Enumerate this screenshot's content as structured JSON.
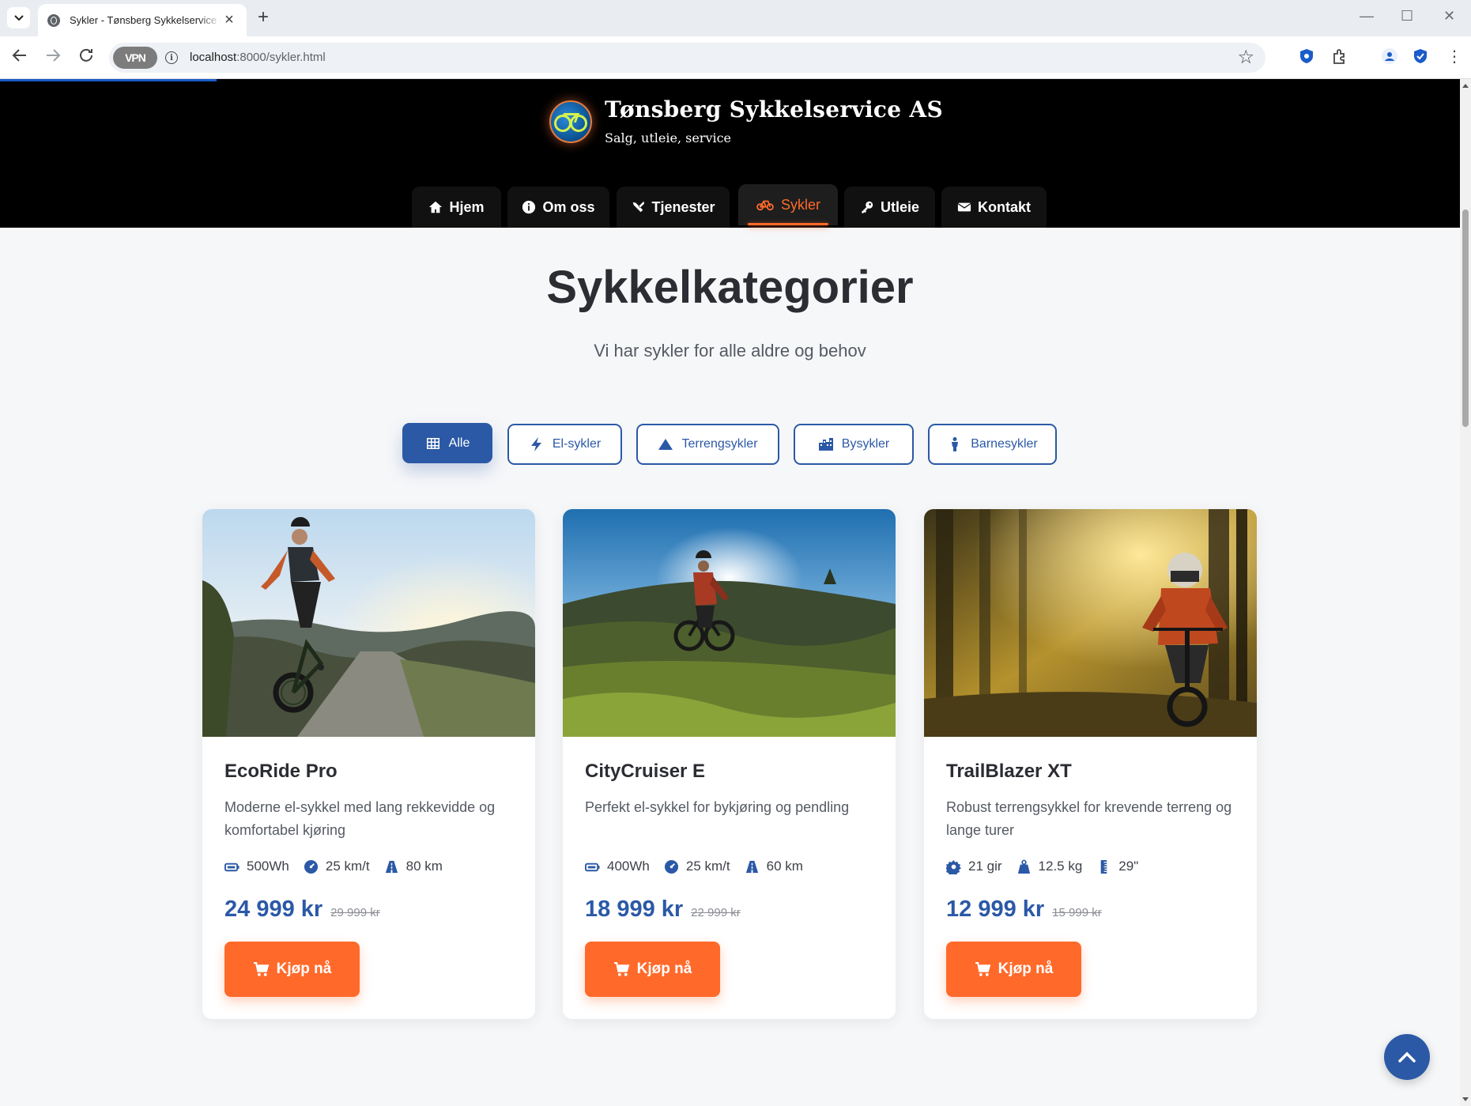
{
  "browser": {
    "tab_title": "Sykler - Tønsberg Sykkelservice og",
    "url_host": "localhost",
    "url_rest": ":8000/sykler.html",
    "vpn_label": "VPN"
  },
  "site": {
    "name": "Tønsberg Sykkelservice AS",
    "tagline": "Salg, utleie, service"
  },
  "nav": [
    {
      "label": "Hjem",
      "icon": "home-icon"
    },
    {
      "label": "Om oss",
      "icon": "info-circle-icon"
    },
    {
      "label": "Tjenester",
      "icon": "tools-icon"
    },
    {
      "label": "Sykler",
      "icon": "bicycle-icon",
      "active": true
    },
    {
      "label": "Utleie",
      "icon": "key-icon"
    },
    {
      "label": "Kontakt",
      "icon": "envelope-icon"
    }
  ],
  "section": {
    "title": "Sykkelkategorier",
    "subtitle": "Vi har sykler for alle aldre og behov"
  },
  "filters": [
    {
      "label": "Alle",
      "icon": "grid-icon",
      "active": true
    },
    {
      "label": "El-sykler",
      "icon": "bolt-icon"
    },
    {
      "label": "Terrengsykler",
      "icon": "mountain-icon"
    },
    {
      "label": "Bysykler",
      "icon": "city-icon"
    },
    {
      "label": "Barnesykler",
      "icon": "child-icon"
    }
  ],
  "products": [
    {
      "name": "EcoRide Pro",
      "description": "Moderne el-sykkel med lang rekkevidde og komfortabel kjøring",
      "specs": [
        {
          "icon": "battery-icon",
          "text": "500Wh"
        },
        {
          "icon": "speedometer-icon",
          "text": "25 km/t"
        },
        {
          "icon": "road-icon",
          "text": "80 km"
        }
      ],
      "price": "24 999 kr",
      "old_price": "29 999 kr",
      "button": "Kjøp nå"
    },
    {
      "name": "CityCruiser E",
      "description": "Perfekt el-sykkel for bykjøring og pendling",
      "specs": [
        {
          "icon": "battery-icon",
          "text": "400Wh"
        },
        {
          "icon": "speedometer-icon",
          "text": "25 km/t"
        },
        {
          "icon": "road-icon",
          "text": "60 km"
        }
      ],
      "price": "18 999 kr",
      "old_price": "22 999 kr",
      "button": "Kjøp nå"
    },
    {
      "name": "TrailBlazer XT",
      "description": "Robust terrengsykkel for krevende terreng og lange turer",
      "specs": [
        {
          "icon": "gear-icon",
          "text": "21 gir"
        },
        {
          "icon": "weight-icon",
          "text": "12.5 kg"
        },
        {
          "icon": "ruler-icon",
          "text": "29\""
        }
      ],
      "price": "12 999 kr",
      "old_price": "15 999 kr",
      "button": "Kjøp nå"
    }
  ],
  "colors": {
    "primary": "#2b59a6",
    "accent": "#ff6a2b",
    "header_bg": "#000000",
    "page_bg": "#f6f7f9"
  }
}
